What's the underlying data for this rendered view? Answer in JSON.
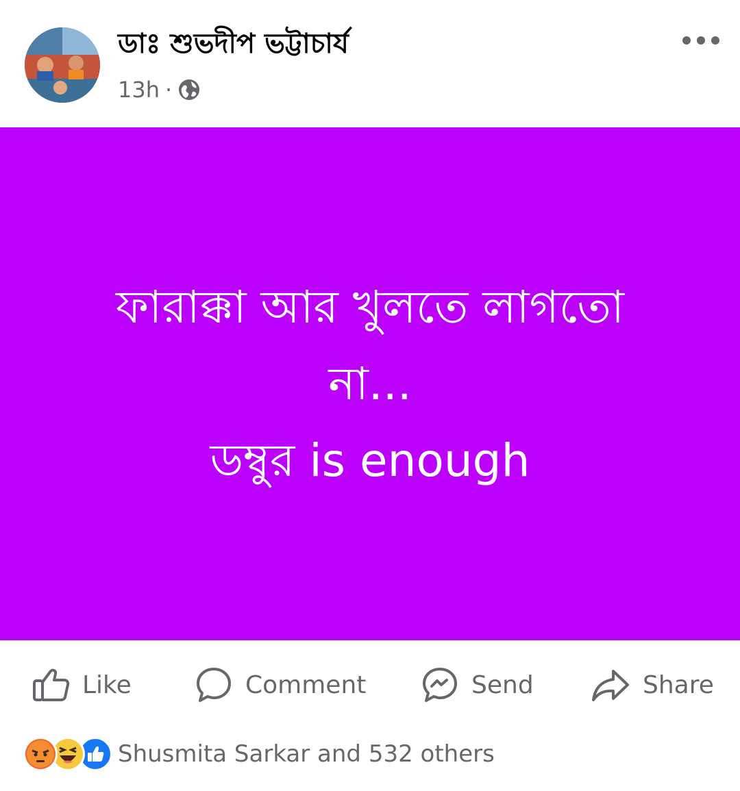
{
  "post": {
    "author": "ডাঃ শুভদীপ ভট্টাচার্য",
    "timestamp": "13h",
    "separator": "·",
    "privacy_icon": "globe-icon",
    "menu_icon": "more-options-icon",
    "background_color": "#bb00fc",
    "text_lines": [
      "ফারাক্কা আর খুলতে লাগতো",
      "না...",
      "ডম্বুর is enough"
    ]
  },
  "actions": {
    "like_label": "Like",
    "comment_label": "Comment",
    "send_label": "Send",
    "share_label": "Share"
  },
  "reactions": {
    "icons": [
      "angry-reaction-icon",
      "haha-reaction-icon",
      "like-reaction-icon"
    ],
    "summary": "Shusmita Sarkar and 532 others"
  }
}
